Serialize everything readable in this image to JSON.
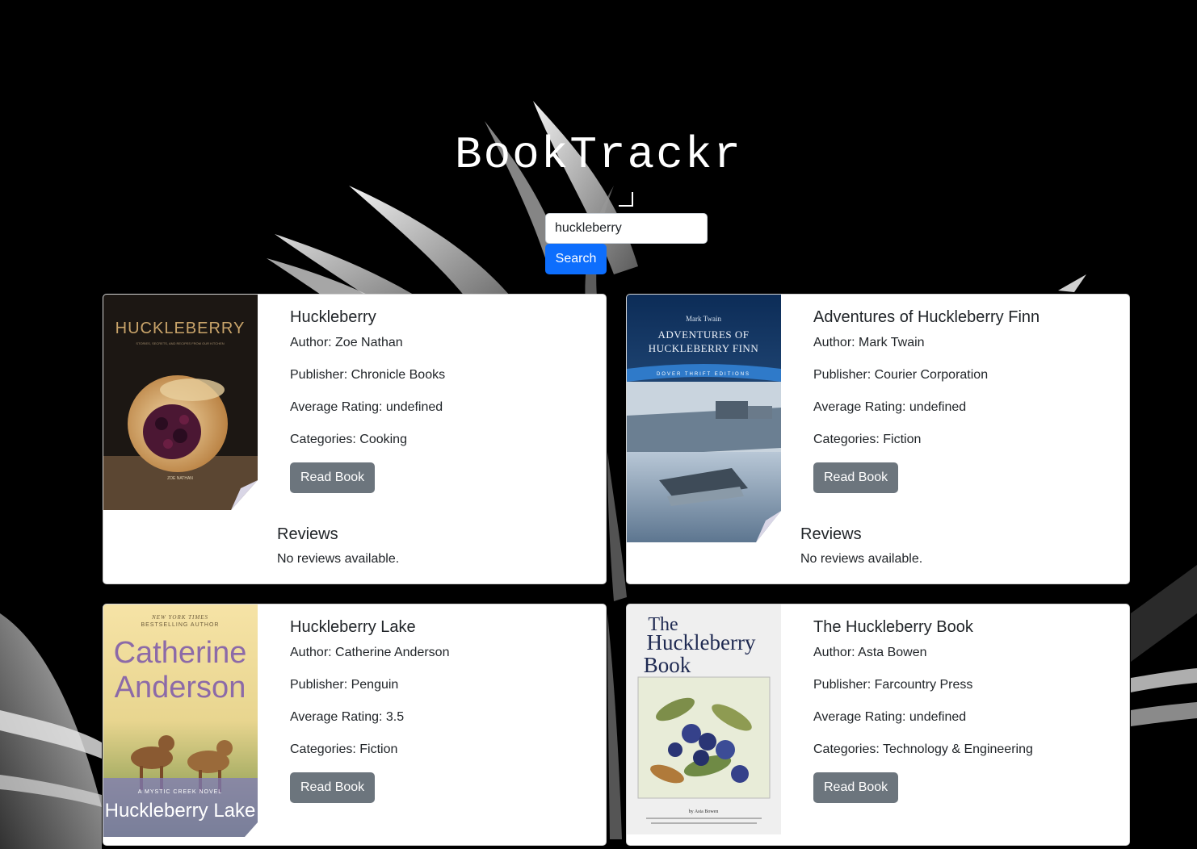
{
  "app": {
    "title": "BookTrackr"
  },
  "search": {
    "value": "huckleberry",
    "button_label": "Search"
  },
  "books": [
    {
      "title": "Huckleberry",
      "author": "Author: Zoe Nathan",
      "publisher": "Publisher: Chronicle Books",
      "rating": "Average Rating: undefined",
      "categories": "Categories: Cooking",
      "button_label": "Read Book",
      "reviews_heading": "Reviews",
      "reviews_text": "No reviews available.",
      "cover": {
        "title": "HUCKLEBERRY",
        "subtitle": "STORIES, SECRETS, AND RECIPES FROM OUR KITCHEN",
        "author": "ZOE NATHAN"
      }
    },
    {
      "title": "Adventures of Huckleberry Finn",
      "author": "Author: Mark Twain",
      "publisher": "Publisher: Courier Corporation",
      "rating": "Average Rating: undefined",
      "categories": "Categories: Fiction",
      "button_label": "Read Book",
      "reviews_heading": "Reviews",
      "reviews_text": "No reviews available.",
      "cover": {
        "author": "Mark Twain",
        "title_line1": "ADVENTURES OF",
        "title_line2": "HUCKLEBERRY FINN",
        "banner": "DOVER THRIFT EDITIONS"
      }
    },
    {
      "title": "Huckleberry Lake",
      "author": "Author: Catherine Anderson",
      "publisher": "Publisher: Penguin",
      "rating": "Average Rating: 3.5",
      "categories": "Categories: Fiction",
      "button_label": "Read Book",
      "cover": {
        "tagline1": "NEW YORK TIMES",
        "tagline2": "BESTSELLING AUTHOR",
        "author_line1": "Catherine",
        "author_line2": "Anderson",
        "series": "A MYSTIC CREEK NOVEL",
        "title": "Huckleberry Lake"
      }
    },
    {
      "title": "The Huckleberry Book",
      "author": "Author: Asta Bowen",
      "publisher": "Publisher: Farcountry Press",
      "rating": "Average Rating: undefined",
      "categories": "Categories: Technology & Engineering",
      "button_label": "Read Book",
      "cover": {
        "line1": "The",
        "line2": "Huckleberry",
        "line3": "Book",
        "byline": "by Asta Bowen"
      }
    }
  ]
}
